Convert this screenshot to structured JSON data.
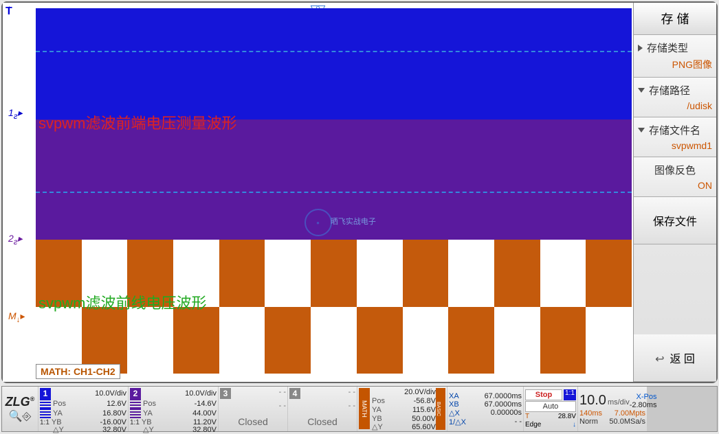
{
  "annotations": {
    "red_text": "svpwm滤波前端电压测量波形",
    "green_text": "svpwm滤波前线电压波形"
  },
  "markers": {
    "trigger": "T",
    "ch1": "1",
    "ch1_suffix": "ƨ",
    "ch2": "2",
    "ch2_suffix": "ƨ",
    "math": "M",
    "math_suffix": "↓"
  },
  "math_label": "MATH: CH1-CH2",
  "watermark_text": "晒飞实战电子",
  "side_panel": {
    "header": "存 储",
    "storage_type": {
      "title": "存储类型",
      "value": "PNG图像"
    },
    "storage_path": {
      "title": "存储路径",
      "value": "/udisk"
    },
    "storage_filename": {
      "title": "存储文件名",
      "value": "svpwmd1"
    },
    "image_invert": {
      "title": "图像反色",
      "value": "ON"
    },
    "save_button": "保存文件",
    "back_button": "返 回"
  },
  "channels": {
    "ch1": {
      "scale": "10.0V/div",
      "pos": "12.6V",
      "ya": "16.80V",
      "yb": "-16.00V",
      "dy": "32.80V",
      "ratio": "1:1"
    },
    "ch2": {
      "scale": "10.0V/div",
      "pos": "-14.6V",
      "ya": "44.00V",
      "yb": "11.20V",
      "dy": "32.80V",
      "ratio": "1:1"
    },
    "ch3": {
      "label": "Closed"
    },
    "ch4": {
      "label": "Closed"
    },
    "math": {
      "scale": "20.0V/div",
      "pos": "-56.8V",
      "ya": "115.6V",
      "yb": "50.00V",
      "dy": "65.60V"
    }
  },
  "labels": {
    "pos": "Pos",
    "ya": "YA",
    "yb": "YB",
    "dy": "△Y"
  },
  "cursors": {
    "xa": {
      "label": "XA",
      "value": "67.0000ms"
    },
    "xb": {
      "label": "XB",
      "value": "67.0000ms"
    },
    "dx": {
      "label": "△X",
      "value": "0.00000s"
    },
    "rate": {
      "label": "1/△X",
      "value": "- -"
    }
  },
  "status": {
    "stop": "Stop",
    "auto": "Auto",
    "trig_level": "28.8V",
    "trig_label": "T",
    "edge": "Edge",
    "edge_icon": "↓"
  },
  "timebase": {
    "value": "10.0",
    "unit": "ms/div",
    "xpos_label": "X-Pos",
    "xpos_value": "-2.80ms",
    "acq_time": "140ms",
    "acq_rate": "7.00Mpts",
    "mode": "Norm",
    "sample": "50.0MSa/s"
  },
  "icons": {
    "basic": "BASIC",
    "ch_indicator": "1:1"
  }
}
